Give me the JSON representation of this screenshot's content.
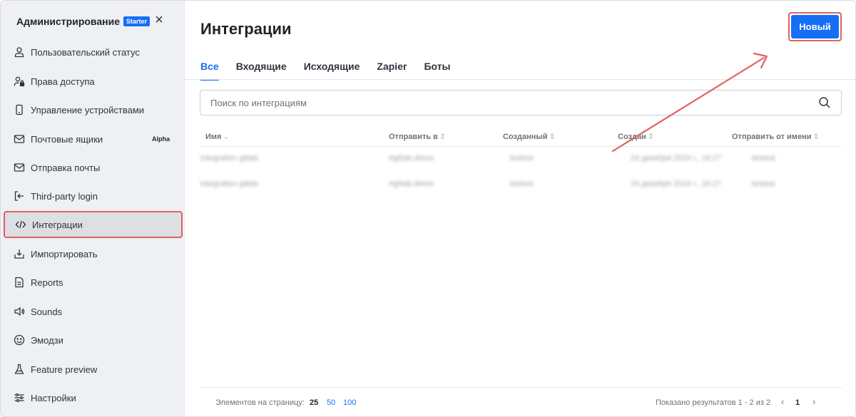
{
  "sidebar": {
    "title": "Администрирование",
    "badge": "Starter",
    "items": [
      {
        "label": "Пользовательский статус",
        "icon": "user-icon"
      },
      {
        "label": "Права доступа",
        "icon": "user-lock-icon"
      },
      {
        "label": "Управление устройствами",
        "icon": "mobile-icon"
      },
      {
        "label": "Почтовые ящики",
        "icon": "mail-icon",
        "badge": "Alpha"
      },
      {
        "label": "Отправка почты",
        "icon": "mail-icon"
      },
      {
        "label": "Third-party login",
        "icon": "login-icon"
      },
      {
        "label": "Интеграции",
        "icon": "code-icon",
        "active": true
      },
      {
        "label": "Импортировать",
        "icon": "import-icon"
      },
      {
        "label": "Reports",
        "icon": "document-icon"
      },
      {
        "label": "Sounds",
        "icon": "speaker-icon"
      },
      {
        "label": "Эмодзи",
        "icon": "emoji-icon"
      },
      {
        "label": "Feature preview",
        "icon": "flask-icon"
      },
      {
        "label": "Настройки",
        "icon": "sliders-icon"
      }
    ]
  },
  "header": {
    "title": "Интеграции",
    "new_button": "Новый"
  },
  "tabs": [
    "Все",
    "Входящие",
    "Исходящие",
    "Zapier",
    "Боты"
  ],
  "search": {
    "placeholder": "Поиск по интеграциям"
  },
  "table": {
    "columns": [
      "Имя",
      "Отправить в",
      "Созданный",
      "Создан",
      "Отправить от имени"
    ],
    "rows": [
      [
        "integration gitlab",
        "#gitlab.demo",
        "testest",
        "24 декабря 2024 г., 16:27",
        "testest"
      ],
      [
        "integration gitlab",
        "#gitlab.demo",
        "testest",
        "24 декабря 2024 г., 16:27",
        "testest"
      ]
    ]
  },
  "pagination": {
    "per_page_label": "Элементов на страницу:",
    "options": [
      "25",
      "50",
      "100"
    ],
    "selected": "25",
    "results": "Показано результатов 1 - 2 из 2",
    "prev": "‹",
    "page": "1",
    "next": "›"
  },
  "colors": {
    "accent": "#156ff5",
    "highlight": "#e06162"
  }
}
